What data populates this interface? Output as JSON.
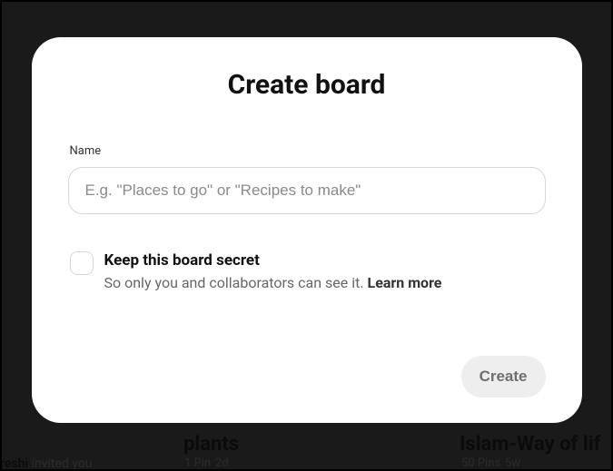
{
  "modal": {
    "title": "Create board",
    "name_label": "Name",
    "name_placeholder": "E.g. \"Places to go\" or \"Recipes to make\"",
    "name_value": "",
    "secret": {
      "title": "Keep this board secret",
      "description_prefix": "So only you and collaborators can see it. ",
      "learn_more_label": "Learn more",
      "checked": false
    },
    "create_button_label": "Create"
  },
  "background": {
    "board1_title": "plants",
    "board1_pins": "1 Pin",
    "board1_time": "2d",
    "board2_title": "Islam-Way of lif",
    "board2_pins": "50 Pins",
    "board2_time": "5w",
    "invite_suffix": "reshi",
    "invite_text": " invited you"
  }
}
